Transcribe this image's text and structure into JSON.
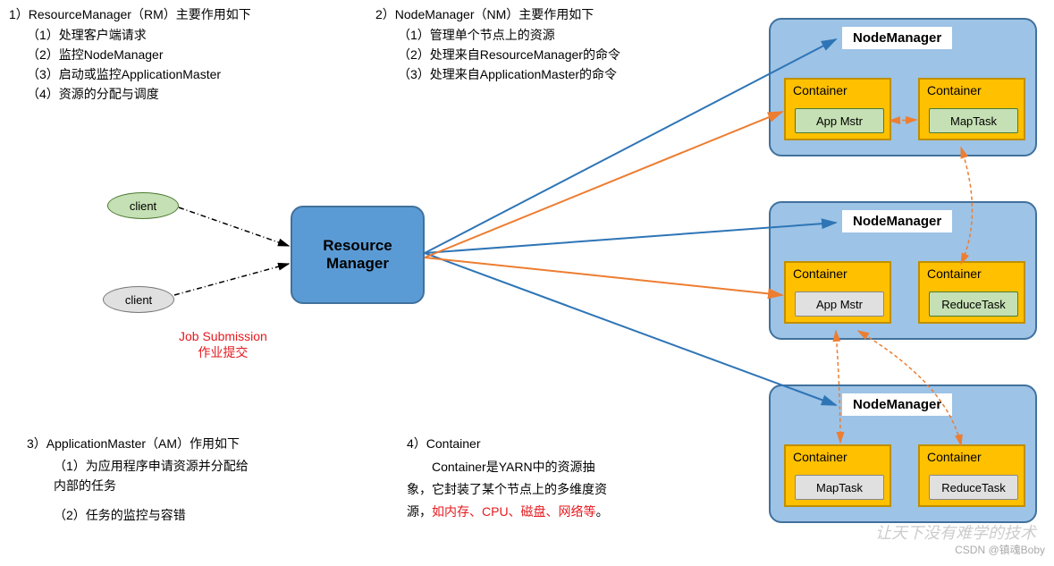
{
  "section1": {
    "title": "1）ResourceManager（RM）主要作用如下",
    "items": [
      "（1）处理客户端请求",
      "（2）监控NodeManager",
      "（3）启动或监控ApplicationMaster",
      "（4）资源的分配与调度"
    ]
  },
  "section2": {
    "title": "2）NodeManager（NM）主要作用如下",
    "items": [
      "（1）管理单个节点上的资源",
      "（2）处理来自ResourceManager的命令",
      "（3）处理来自ApplicationMaster的命令"
    ]
  },
  "section3": {
    "title": "3）ApplicationMaster（AM）作用如下",
    "items": [
      "（1）为应用程序申请资源并分配给内部的任务",
      "（2）任务的监控与容错"
    ]
  },
  "section4": {
    "title": "4）Container",
    "body_plain": "Container是YARN中的资源抽象，它封装了某个节点上的多维度资源，",
    "body_red": "如内存、CPU、磁盘、网络等",
    "body_end": "。"
  },
  "nodes": {
    "client": "client",
    "rm": "Resource Manager",
    "nm": "NodeManager",
    "container": "Container",
    "appmstr": "App Mstr",
    "maptask": "MapTask",
    "reducetask": "ReduceTask"
  },
  "labels": {
    "job_submission": "Job Submission",
    "job_submission_zh": "作业提交"
  },
  "watermark": {
    "line1": "让天下没有难学的技术",
    "line2": "CSDN @镇魂Boby"
  }
}
